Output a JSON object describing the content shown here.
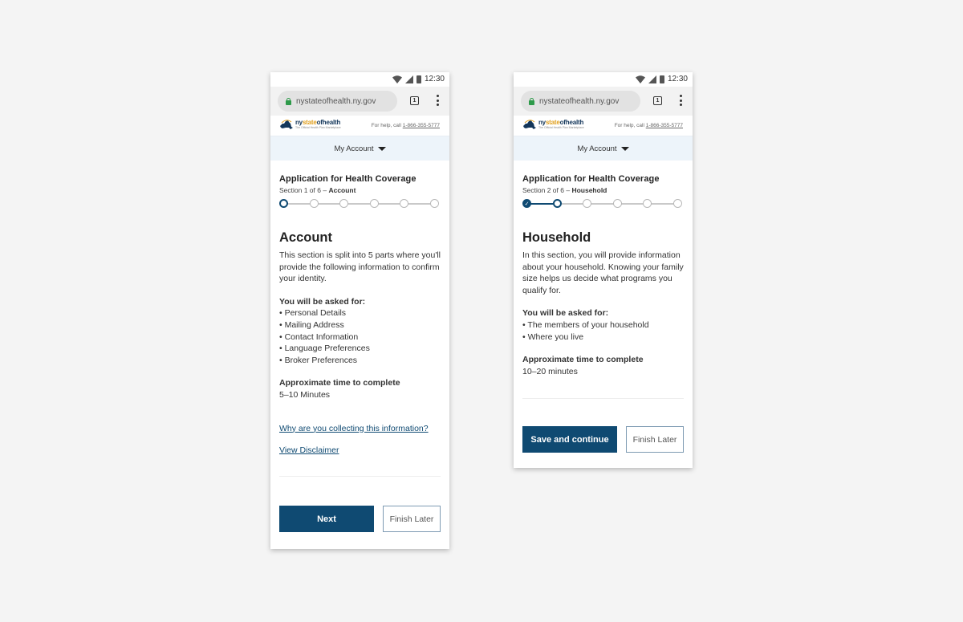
{
  "phones": [
    {
      "status_time": "12:30",
      "url": "nystateofhealth.ny.gov",
      "tab_count": "1",
      "logo": {
        "part1": "ny",
        "part2": "state",
        "part3": "ofhealth",
        "tagline": "The Official Health Plan Marketplace"
      },
      "help_label": "For help, call",
      "help_phone": "1-866-355-5777",
      "account_label": "My Account",
      "app_title": "Application for Health Coverage",
      "section_prefix": "Section 1 of 6 –",
      "section_name": "Account",
      "steps_total": 6,
      "steps_completed": 0,
      "current_step": 1,
      "heading": "Account",
      "intro": "This section is split into 5 parts where you'll provide the following information to confirm your identity.",
      "asked_label": "You will be asked for:",
      "asked_items": [
        "• Personal Details",
        "• Mailing Address",
        "• Contact Information",
        "• Language Preferences",
        "• Broker Preferences"
      ],
      "time_label": "Approximate time to complete",
      "time_value": "5–10 Minutes",
      "link_why": "Why are you collecting this information?",
      "link_disclaimer": "View Disclaimer",
      "primary_button": "Next",
      "secondary_button": "Finish Later"
    },
    {
      "status_time": "12:30",
      "url": "nystateofhealth.ny.gov",
      "tab_count": "1",
      "logo": {
        "part1": "ny",
        "part2": "state",
        "part3": "ofhealth",
        "tagline": "The Official Health Plan Marketplace"
      },
      "help_label": "For help, call",
      "help_phone": "1-866-355-5777",
      "account_label": "My Account",
      "app_title": "Application for Health Coverage",
      "section_prefix": "Section 2 of 6 –",
      "section_name": "Household",
      "steps_total": 6,
      "steps_completed": 1,
      "current_step": 2,
      "heading": "Household",
      "intro": "In this section, you will provide information about your household. Knowing your family size helps us decide what programs you qualify for.",
      "asked_label": "You will be asked for:",
      "asked_items": [
        "• The members of your household",
        "• Where you live"
      ],
      "time_label": "Approximate time to complete",
      "time_value": "10–20 minutes",
      "primary_button": "Save and continue",
      "secondary_button": "Finish Later"
    }
  ],
  "colors": {
    "primary": "#0f4a72",
    "account_bar": "#edf4fa",
    "lock": "#2e9a4a",
    "logo_accent": "#e0a020"
  }
}
